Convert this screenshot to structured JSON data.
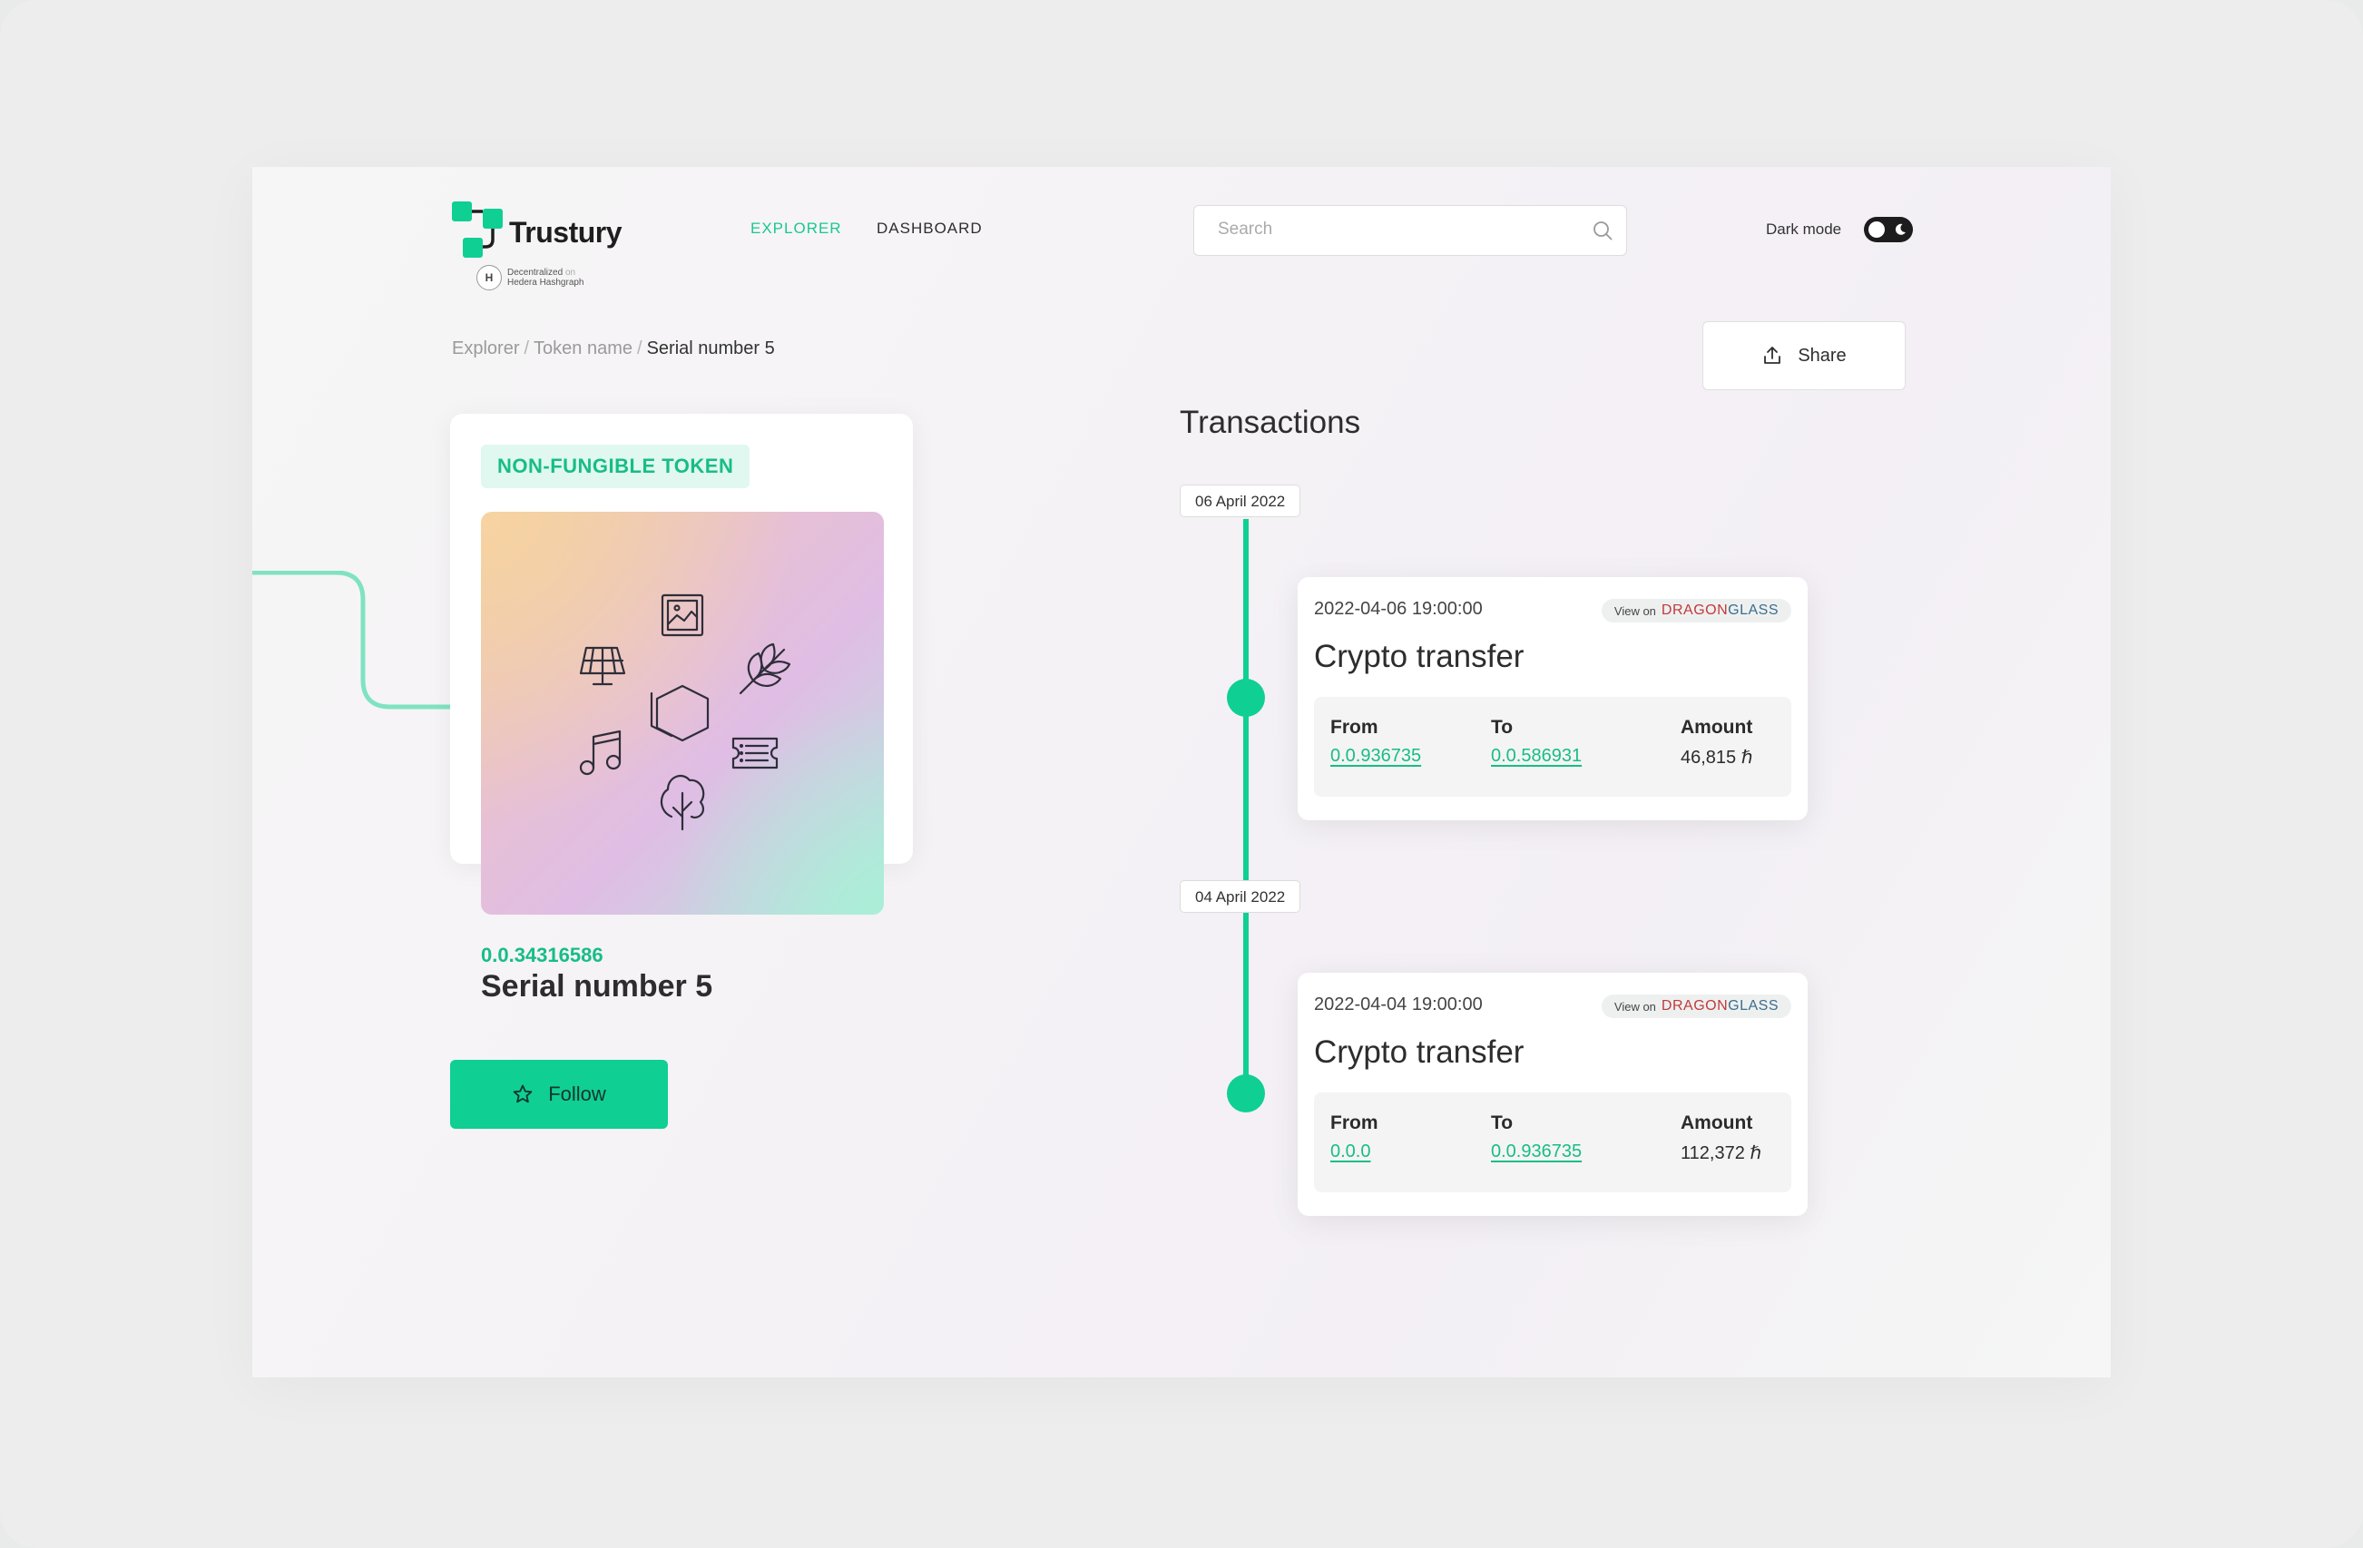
{
  "brand": {
    "name": "Trustury",
    "sub_line1": "Decentralized",
    "sub_on": "on",
    "sub_line2": "Hedera Hashgraph",
    "hedera_letter": "H",
    "accent": "#10cf93"
  },
  "nav": {
    "explorer": "EXPLORER",
    "dashboard": "DASHBOARD",
    "active": "explorer"
  },
  "search": {
    "placeholder": "Search",
    "value": ""
  },
  "darkmode": {
    "label": "Dark mode",
    "enabled": false,
    "icon": "moon-icon"
  },
  "breadcrumb": {
    "items": [
      "Explorer",
      "Token name"
    ],
    "current": "Serial number 5",
    "separator": "/"
  },
  "share": {
    "label": "Share",
    "icon": "share-icon"
  },
  "token": {
    "badge": "NON-FUNGIBLE TOKEN",
    "id": "0.0.34316586",
    "title": "Serial number 5",
    "image_icons": [
      "image-icon",
      "solar-panel-icon",
      "leaf-icon",
      "hexagon-icon",
      "music-icon",
      "ticket-icon",
      "tree-icon"
    ]
  },
  "follow": {
    "label": "Follow",
    "icon": "star-icon"
  },
  "transactions": {
    "heading": "Transactions",
    "groups": [
      {
        "date": "06 April 2022",
        "timestamp": "2022-04-06 19:00:00",
        "view_on": "View on",
        "provider_a": "DRAGON",
        "provider_b": "GLASS",
        "type": "Crypto transfer",
        "from_label": "From",
        "from": "0.0.936735",
        "to_label": "To",
        "to": "0.0.586931",
        "amount_label": "Amount",
        "amount": "46,815 ℏ"
      },
      {
        "date": "04 April 2022",
        "timestamp": "2022-04-04 19:00:00",
        "view_on": "View on",
        "provider_a": "DRAGON",
        "provider_b": "GLASS",
        "type": "Crypto transfer",
        "from_label": "From",
        "from": "0.0.0",
        "to_label": "To",
        "to": " 0.0.936735",
        "amount_label": "Amount",
        "amount": "112,372 ℏ"
      }
    ]
  }
}
